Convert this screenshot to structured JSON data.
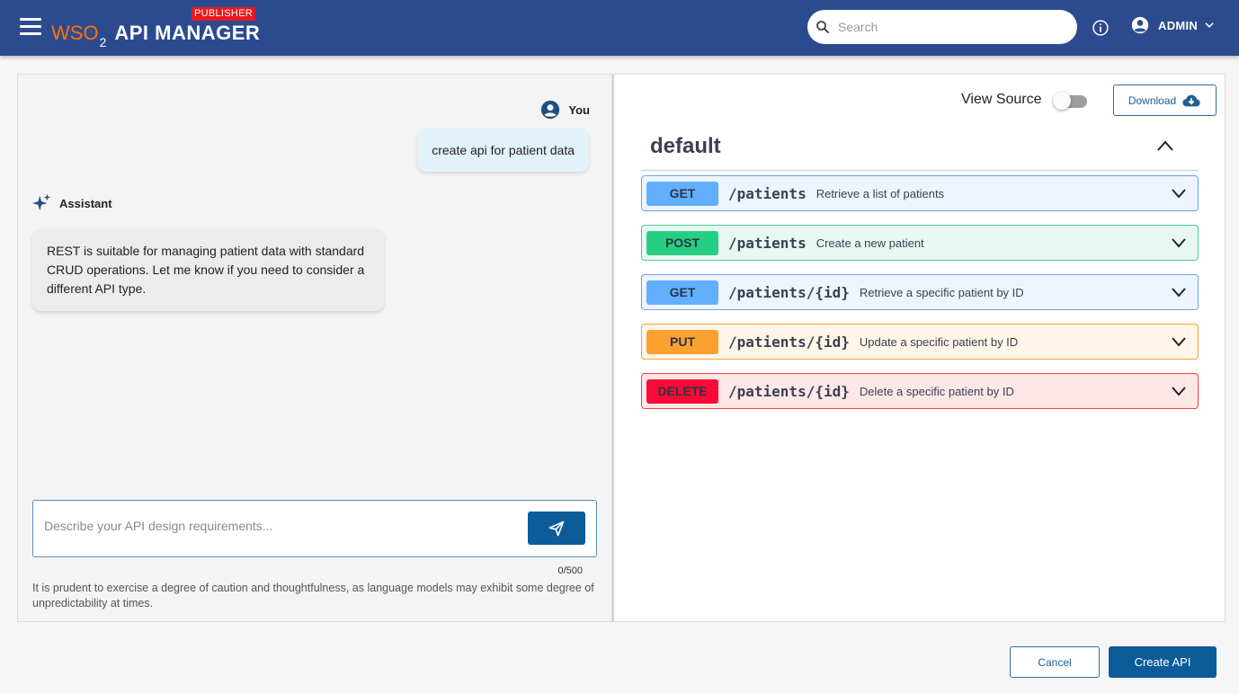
{
  "header": {
    "logo_brand": "WSO",
    "logo_sub": "2",
    "product": "API MANAGER",
    "badge": "PUBLISHER",
    "search_placeholder": "Search",
    "user": "ADMIN",
    "colors": {
      "bar": "#2c4b8f",
      "brand_orange": "#ff7300",
      "badge": "#e8191e"
    }
  },
  "chat": {
    "user_label": "You",
    "user_message": "create api for patient data",
    "assistant_label": "Assistant",
    "assistant_message": "REST is suitable for managing patient data with standard CRUD operations. Let me know if you need to consider a different API type.",
    "input_placeholder": "Describe your API design requirements...",
    "char_count": "0/500",
    "disclaimer": "It is prudent to exercise a degree of caution and thoughtfulness, as language models may exhibit some degree of unpredictability at times."
  },
  "spec": {
    "view_source_label": "View Source",
    "view_source_on": false,
    "download_label": "Download",
    "section_title": "default",
    "operations": [
      {
        "method": "GET",
        "path": "/patients",
        "description": "Retrieve a list of patients"
      },
      {
        "method": "POST",
        "path": "/patients",
        "description": "Create a new patient"
      },
      {
        "method": "GET",
        "path": "/patients/{id}",
        "description": "Retrieve a specific patient by ID"
      },
      {
        "method": "PUT",
        "path": "/patients/{id}",
        "description": "Update a specific patient by ID"
      },
      {
        "method": "DELETE",
        "path": "/patients/{id}",
        "description": "Delete a specific patient by ID"
      }
    ]
  },
  "footer": {
    "cancel_label": "Cancel",
    "create_label": "Create API"
  },
  "icons": [
    "menu-icon",
    "search-icon",
    "info-icon",
    "user-account-icon",
    "chevron-down-icon",
    "sparkle-icon",
    "send-icon",
    "cloud-download-icon",
    "chevron-up-icon"
  ]
}
